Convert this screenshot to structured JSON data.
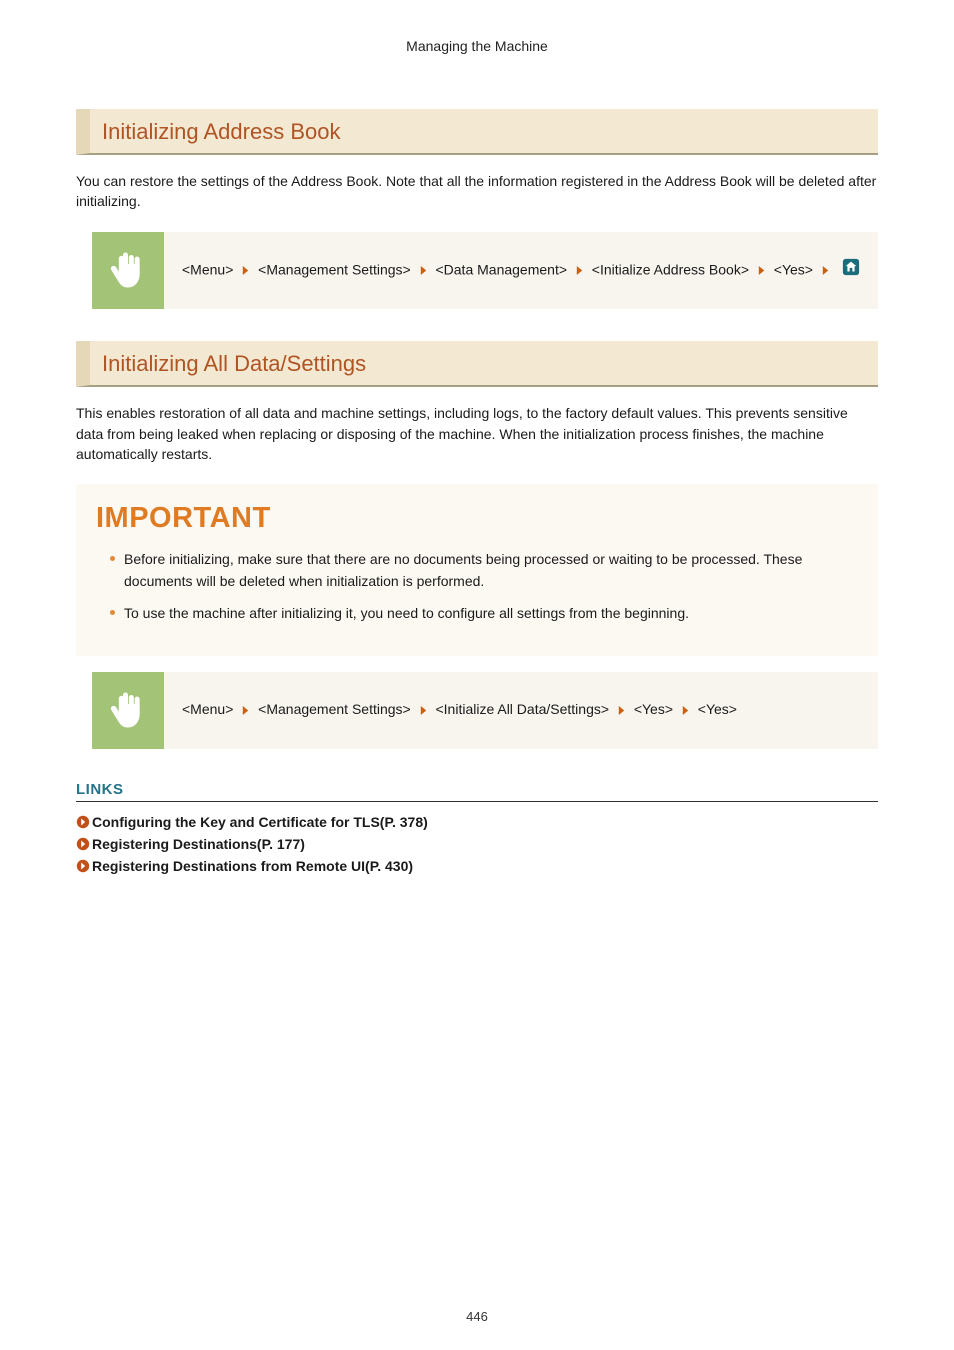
{
  "page_top_title": "Managing the Machine",
  "section1": {
    "heading": "Initializing Address Book",
    "body": "You can restore the settings of the Address Book. Note that all the information registered in the Address Book will be deleted after initializing.",
    "steps": [
      "<Menu>",
      "<Management Settings>",
      "<Data Management>",
      "<Initialize Address Book>",
      "<Yes>"
    ],
    "has_home_icon": true
  },
  "section2": {
    "heading": "Initializing All Data/Settings",
    "body": "This enables restoration of all data and machine settings, including logs, to the factory default values. This prevents sensitive data from being leaked when replacing or disposing of the machine. When the initialization process finishes, the machine automatically restarts.",
    "important_title": "IMPORTANT",
    "important_items": [
      "Before initializing, make sure that there are no documents being processed or waiting to be processed. These documents will be deleted when initialization is performed.",
      "To use the machine after initializing it, you need to configure all settings from the beginning."
    ],
    "steps": [
      "<Menu>",
      "<Management Settings>",
      "<Initialize All Data/Settings>",
      "<Yes>",
      "<Yes>"
    ],
    "has_home_icon": false
  },
  "links": {
    "heading": "LINKS",
    "items": [
      "Configuring the Key and Certificate for TLS(P. 378)",
      "Registering Destinations(P. 177)",
      "Registering Destinations from Remote UI(P. 430)"
    ]
  },
  "page_number": "446"
}
